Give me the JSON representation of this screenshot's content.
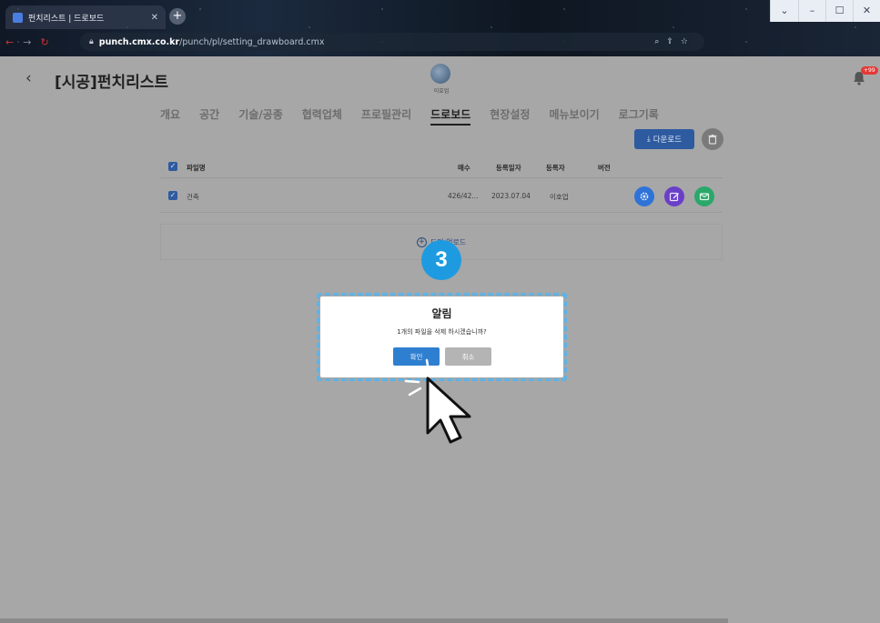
{
  "browser": {
    "tab_title": "펀치리스트 | 드로보드",
    "tab_close": "✕",
    "new_tab": "+",
    "url_host": "punch.cmx.co.kr",
    "url_path": "/punch/pl/setting_drawboard.cmx",
    "window_controls": [
      "⌄",
      "–",
      "☐",
      "✕"
    ]
  },
  "header": {
    "back": "‹",
    "title": "[시공]펀치리스트",
    "logo_caption": "이호업",
    "notification_badge": "+99"
  },
  "tabs": [
    {
      "label": "개요",
      "active": false
    },
    {
      "label": "공간",
      "active": false
    },
    {
      "label": "기술/공종",
      "active": false
    },
    {
      "label": "협력업체",
      "active": false
    },
    {
      "label": "프로필관리",
      "active": false
    },
    {
      "label": "드로보드",
      "active": true
    },
    {
      "label": "현장설정",
      "active": false
    },
    {
      "label": "메뉴보이기",
      "active": false
    },
    {
      "label": "로그기록",
      "active": false
    }
  ],
  "toolbar": {
    "download_icon": "⤓",
    "download_label": "다운로드"
  },
  "table": {
    "headers": {
      "name": "파일명",
      "pages": "매수",
      "date": "등록일자",
      "author": "등록자",
      "version": "버전"
    },
    "check": "✓",
    "rows": [
      {
        "name": "건축",
        "pages": "426/42...",
        "date": "2023.07.04",
        "author": "이호업",
        "version": ""
      }
    ]
  },
  "upload": {
    "label": "도면 업로드",
    "plus": "+"
  },
  "step_number": "3",
  "dialog": {
    "title": "알림",
    "message": "1개의 파일을 삭제 하시겠습니까?",
    "ok_label": "확인",
    "cancel_label": "취소"
  },
  "colors": {
    "primary": "#2e5aa0",
    "step_marker": "#1e9be0",
    "dialog_frame": "#5eb3e6",
    "settings_action": "#2f73d8",
    "edit_action": "#6a3fc8",
    "mail_action": "#2aa86a"
  }
}
